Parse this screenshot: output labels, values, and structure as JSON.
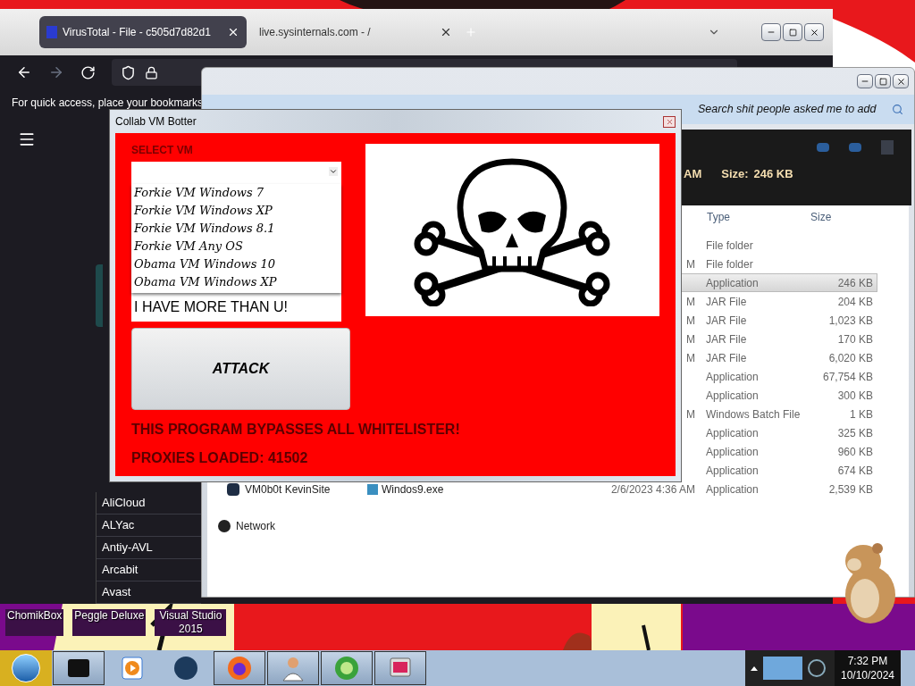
{
  "desktop_icons": [
    {
      "label": "ChomikBox"
    },
    {
      "label": "Peggle Deluxe"
    },
    {
      "label": "Visual Studio 2015"
    }
  ],
  "browser": {
    "tabs": [
      {
        "title": "VirusTotal - File - c505d7d82d1",
        "selected": true
      },
      {
        "title": "live.sysinternals.com - /",
        "selected": false
      }
    ],
    "bookmarks_hint": "For quick access, place your bookmarks",
    "engines": [
      "AliCloud",
      "ALYac",
      "Antiy-AVL",
      "Arcabit",
      "Avast"
    ]
  },
  "explorer": {
    "search": {
      "placeholder": "Search shit people asked me to add"
    },
    "details": {
      "date": "AM",
      "size_label": "Size:",
      "size": "246 KB"
    },
    "columns": [
      "Type",
      "Size"
    ],
    "rows": [
      {
        "type": "File folder",
        "selected": false
      },
      {
        "date": "M",
        "type": "File folder",
        "selected": false
      },
      {
        "type": "Application",
        "size": "246 KB",
        "selected": true
      },
      {
        "date": "M",
        "type": "JAR File",
        "size": "204 KB",
        "selected": false
      },
      {
        "date": "M",
        "type": "JAR File",
        "size": "1,023 KB",
        "selected": false
      },
      {
        "date": "M",
        "type": "JAR File",
        "size": "170 KB",
        "selected": false
      },
      {
        "date": "M",
        "type": "JAR File",
        "size": "6,020 KB",
        "selected": false
      },
      {
        "type": "Application",
        "size": "67,754 KB",
        "selected": false
      },
      {
        "type": "Application",
        "size": "300 KB",
        "selected": false
      },
      {
        "date": "M",
        "type": "Windows Batch File",
        "size": "1 KB",
        "selected": false
      },
      {
        "type": "Application",
        "size": "325 KB",
        "selected": false
      },
      {
        "type": "Application",
        "size": "960 KB",
        "selected": false
      },
      {
        "type": "Application",
        "size": "674 KB",
        "selected": false
      },
      {
        "name": "Windos9.exe",
        "date": "2/6/2023 4:36 AM",
        "type": "Application",
        "size": "2,539 KB",
        "selected": false
      }
    ],
    "nav": [
      {
        "label": "VM0b0t KevinSite",
        "kind": "computer"
      },
      {
        "label": "Network",
        "kind": "network"
      }
    ]
  },
  "dialog": {
    "title": "Collab VM Botter",
    "select_label": "SELECT VM",
    "options": [
      "Forkie VM Windows 7",
      "Forkie VM Windows XP",
      "Forkie VM Windows 8.1",
      "Forkie VM Any OS",
      "Obama VM Windows 10",
      "Obama VM Windows XP"
    ],
    "subtitle": "I HAVE MORE THAN U!",
    "button": "ATTACK",
    "lines": [
      "THIS PROGRAM BYPASSES ALL WHITELISTER!",
      "PROXIES LOADED: 41502"
    ]
  },
  "taskbar": {
    "time": "7:32 PM",
    "date": "10/10/2024"
  }
}
